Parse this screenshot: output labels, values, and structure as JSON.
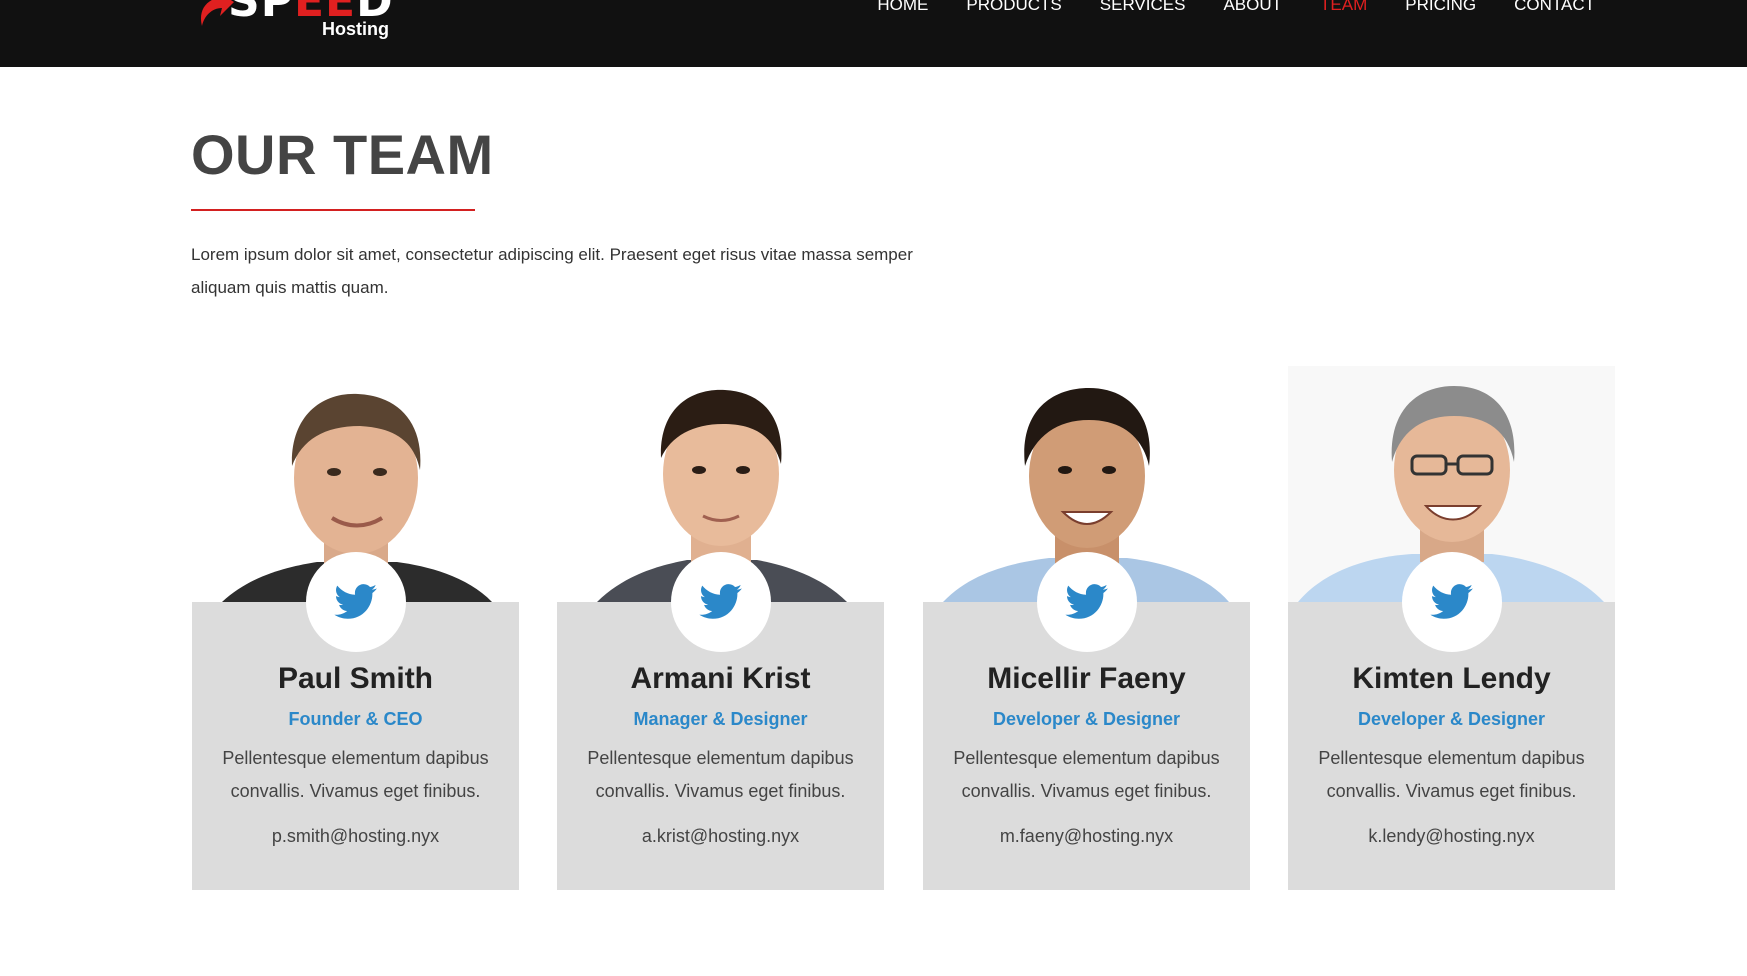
{
  "brand": {
    "name_part1": "SP",
    "name_part2": "EE",
    "name_part3": "D",
    "sub": "Hosting"
  },
  "nav": [
    {
      "label": "HOME",
      "active": false
    },
    {
      "label": "PRODUCTS",
      "active": false
    },
    {
      "label": "SERVICES",
      "active": false
    },
    {
      "label": "ABOUT",
      "active": false
    },
    {
      "label": "TEAM",
      "active": true
    },
    {
      "label": "PRICING",
      "active": false
    },
    {
      "label": "CONTACT",
      "active": false
    }
  ],
  "section": {
    "title": "OUR TEAM",
    "intro": "Lorem ipsum dolor sit amet, consectetur adipiscing elit. Praesent eget risus vitae massa semper aliquam quis mattis quam."
  },
  "team": [
    {
      "name": "Paul Smith",
      "role": "Founder & CEO",
      "bio": "Pellentesque elementum dapibus convallis. Vivamus eget finibus.",
      "email": "p.smith@hosting.nyx",
      "icon": "twitter-icon"
    },
    {
      "name": "Armani Krist",
      "role": "Manager & Designer",
      "bio": "Pellentesque elementum dapibus convallis. Vivamus eget finibus.",
      "email": "a.krist@hosting.nyx",
      "icon": "twitter-icon"
    },
    {
      "name": "Micellir Faeny",
      "role": "Developer & Designer",
      "bio": "Pellentesque elementum dapibus convallis. Vivamus eget finibus.",
      "email": "m.faeny@hosting.nyx",
      "icon": "twitter-icon"
    },
    {
      "name": "Kimten Lendy",
      "role": "Developer & Designer",
      "bio": "Pellentesque elementum dapibus convallis. Vivamus eget finibus.",
      "email": "k.lendy@hosting.nyx",
      "icon": "twitter-icon"
    }
  ],
  "colors": {
    "accent_red": "#e02020",
    "role_blue": "#2b88c9",
    "twitter_blue": "#2b88c9",
    "panel_gray": "#dcdcdc",
    "header_bg": "#111111"
  }
}
